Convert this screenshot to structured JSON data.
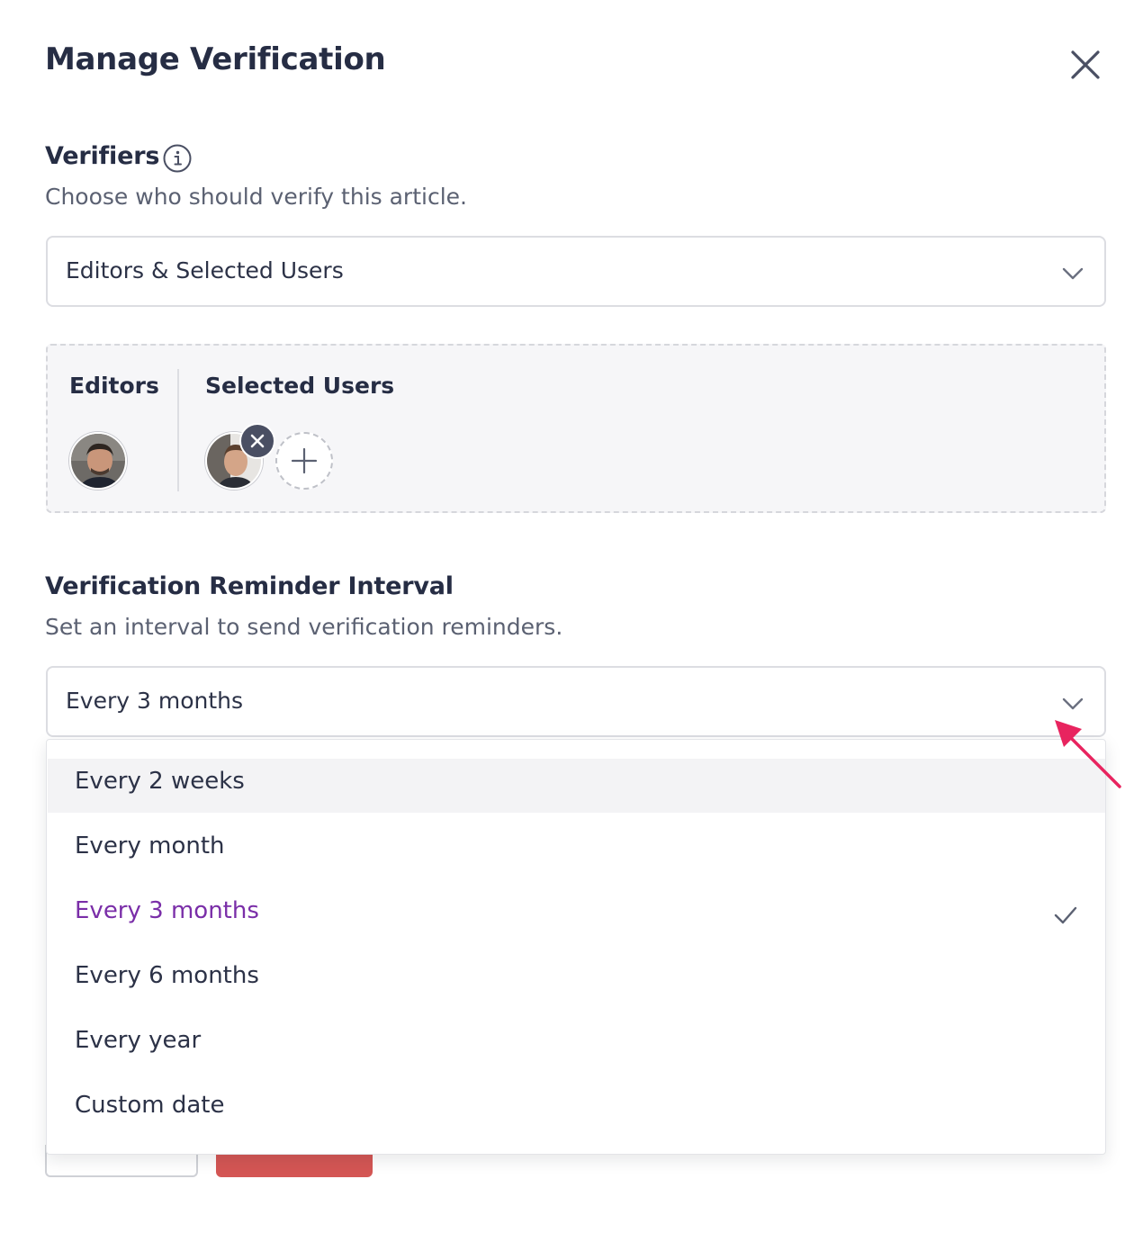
{
  "modal": {
    "title": "Manage Verification"
  },
  "verifiers": {
    "title": "Verifiers",
    "description": "Choose who should verify this article.",
    "select_value": "Editors & Selected Users",
    "editors_label": "Editors",
    "selected_users_label": "Selected Users"
  },
  "interval": {
    "title": "Verification Reminder Interval",
    "description": "Set an interval to send verification reminders.",
    "select_value": "Every 3 months",
    "options": [
      {
        "label": "Every 2 weeks"
      },
      {
        "label": "Every month"
      },
      {
        "label": "Every 3 months"
      },
      {
        "label": "Every 6 months"
      },
      {
        "label": "Every year"
      },
      {
        "label": "Custom date"
      }
    ]
  },
  "colors": {
    "selected_option": "#7a2ea8",
    "danger_button": "#d45654",
    "annotation_arrow": "#e8245f"
  },
  "icons": {
    "close": "close-icon",
    "info": "info-icon",
    "chevron": "chevron-down-icon",
    "check": "check-icon",
    "add": "plus-icon",
    "remove": "x-icon"
  }
}
